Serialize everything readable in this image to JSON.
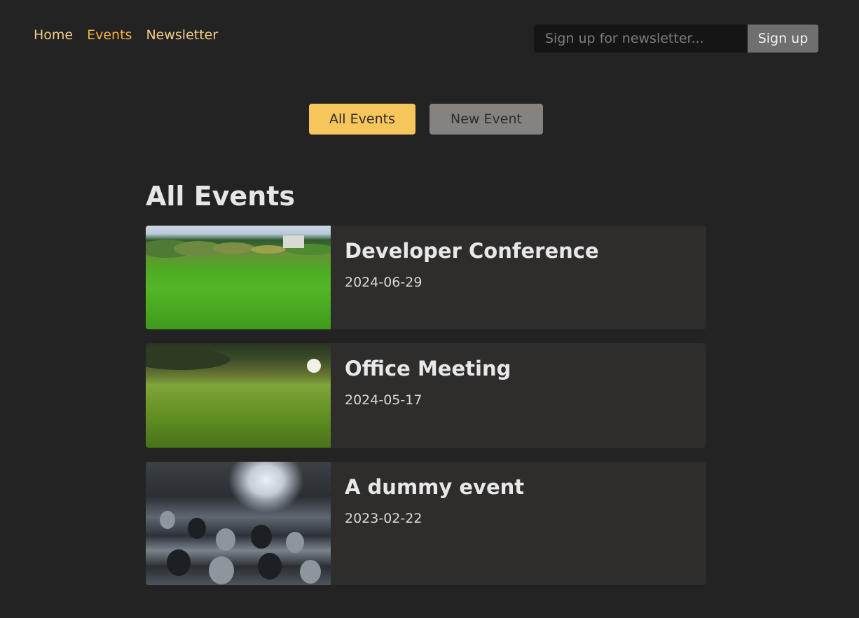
{
  "nav": {
    "items": [
      {
        "label": "Home",
        "active": false
      },
      {
        "label": "Events",
        "active": true
      },
      {
        "label": "Newsletter",
        "active": false
      }
    ]
  },
  "newsletter": {
    "placeholder": "Sign up for newsletter...",
    "value": "",
    "button_label": "Sign up"
  },
  "events_nav": {
    "tabs": [
      {
        "label": "All Events",
        "active": true
      },
      {
        "label": "New Event",
        "active": false
      }
    ]
  },
  "main": {
    "title": "All Events",
    "events": [
      {
        "title": "Developer Conference",
        "date": "2024-06-29"
      },
      {
        "title": "Office Meeting",
        "date": "2024-05-17"
      },
      {
        "title": "A dummy event",
        "date": "2023-02-22"
      }
    ]
  },
  "colors": {
    "background": "#232323",
    "accent": "#f6c55c",
    "nav_link": "#f4cd86",
    "nav_link_active": "#f3b23e",
    "card": "#2f2d2c"
  }
}
